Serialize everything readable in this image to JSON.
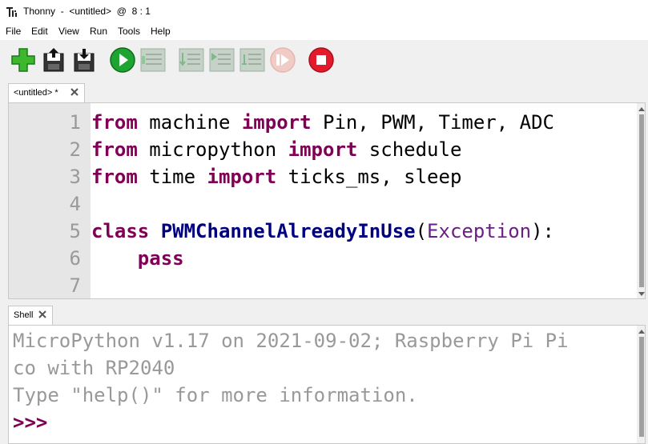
{
  "window": {
    "title": "Thonny  -  <untitled>  @  8 : 1",
    "app_icon": "thonny-logo-icon"
  },
  "menu": [
    "File",
    "Edit",
    "View",
    "Run",
    "Tools",
    "Help"
  ],
  "toolbar": [
    {
      "icon": "new-file-icon",
      "color": "#3cb72e"
    },
    {
      "icon": "open-file-icon",
      "color": "#222222"
    },
    {
      "icon": "save-file-icon",
      "color": "#222222"
    },
    {
      "icon": "run-icon",
      "color": "#1fa431"
    },
    {
      "icon": "debug-icon",
      "color": "#9fb0a3"
    },
    {
      "icon": "step-over-icon",
      "color": "#9fb0a3"
    },
    {
      "icon": "step-into-icon",
      "color": "#9fb0a3"
    },
    {
      "icon": "step-out-icon",
      "color": "#9fb0a3"
    },
    {
      "icon": "resume-icon",
      "color": "#e6b5ae"
    },
    {
      "icon": "stop-icon",
      "color": "#e21a2b"
    }
  ],
  "editor": {
    "tab_label": "<untitled> *",
    "line_numbers": [
      "1",
      "2",
      "3",
      "4",
      "5",
      "6",
      "7"
    ],
    "lines": [
      [
        {
          "t": "from",
          "c": "kw"
        },
        {
          "t": " machine "
        },
        {
          "t": "import",
          "c": "kw"
        },
        {
          "t": " Pin, PWM, Timer, ADC"
        }
      ],
      [
        {
          "t": "from",
          "c": "kw"
        },
        {
          "t": " micropython "
        },
        {
          "t": "import",
          "c": "kw"
        },
        {
          "t": " schedule"
        }
      ],
      [
        {
          "t": "from",
          "c": "kw"
        },
        {
          "t": " time "
        },
        {
          "t": "import",
          "c": "kw"
        },
        {
          "t": " ticks_ms, sleep"
        }
      ],
      [],
      [
        {
          "t": "class",
          "c": "kw"
        },
        {
          "t": " "
        },
        {
          "t": "PWMChannelAlreadyInUse",
          "c": "cls"
        },
        {
          "t": "("
        },
        {
          "t": "Exception",
          "c": "bi"
        },
        {
          "t": "):"
        }
      ],
      [
        {
          "t": "    "
        },
        {
          "t": "pass",
          "c": "kw"
        }
      ],
      []
    ]
  },
  "shell": {
    "tab_label": "Shell",
    "lines": [
      "MicroPython v1.17 on 2021-09-02; Raspberry Pi Pi",
      "co with RP2040",
      "Type \"help()\" for more information."
    ],
    "prompt": ">>>"
  },
  "colors": {
    "keyword": "#7f0055",
    "class_name": "#00007f",
    "builtin": "#6b1e83",
    "shell_text": "#999999",
    "gutter_bg": "#e6e6e6"
  }
}
